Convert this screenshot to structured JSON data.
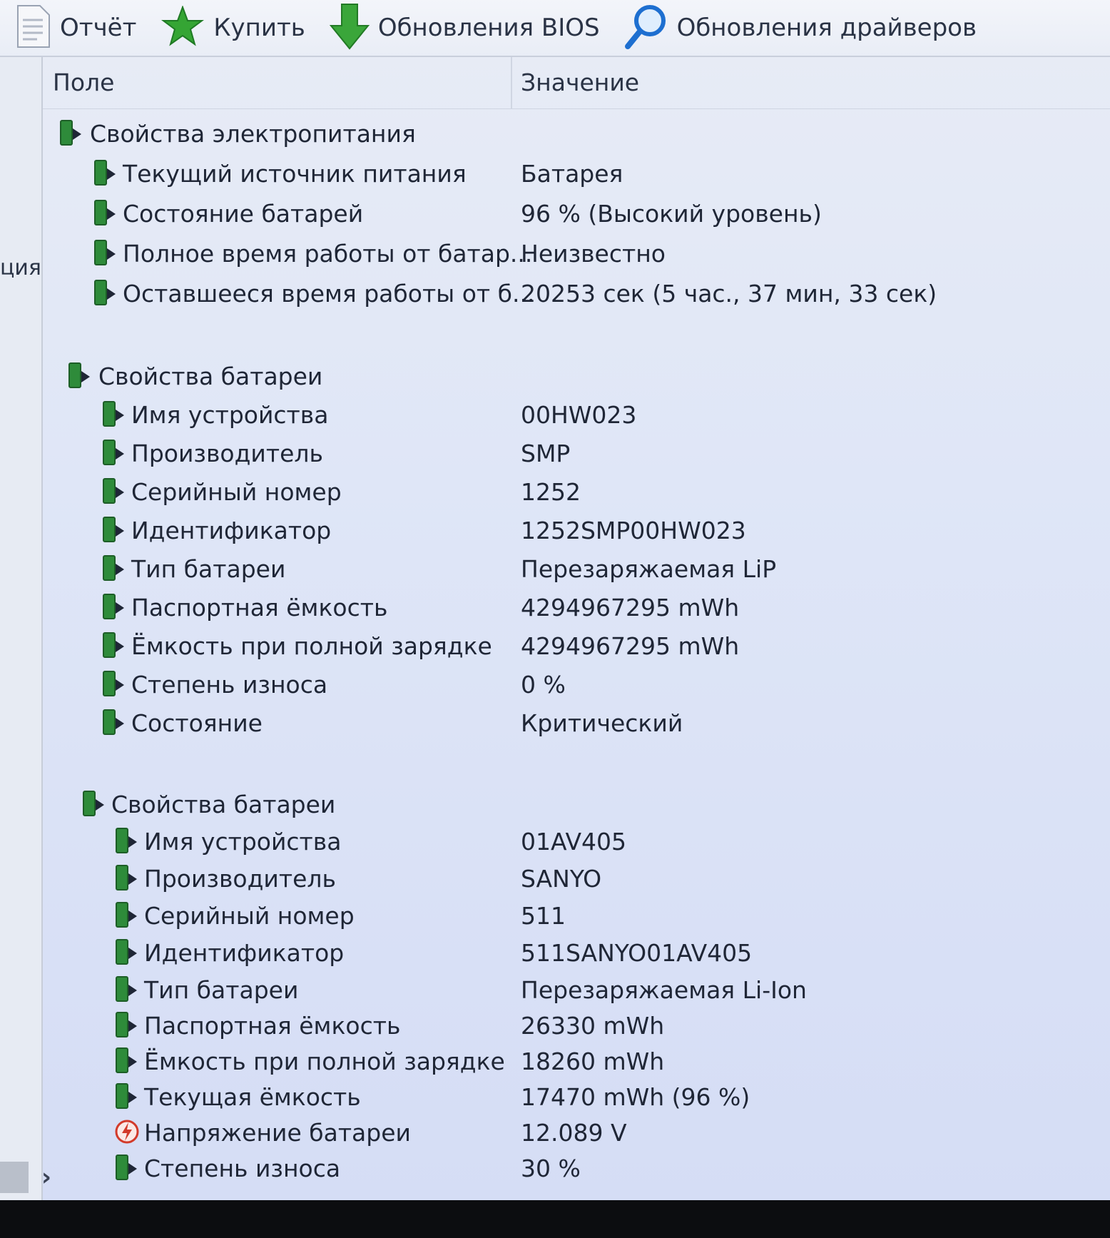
{
  "toolbar": {
    "items": [
      {
        "label": "Отчёт",
        "icon": "report-icon"
      },
      {
        "label": "Купить",
        "icon": "buy-star-icon"
      },
      {
        "label": "Обновления BIOS",
        "icon": "download-arrow-icon"
      },
      {
        "label": "Обновления драйверов",
        "icon": "search-magnifier-icon"
      }
    ]
  },
  "left_pane": {
    "clipped_text": "ция"
  },
  "columns": {
    "field": "Поле",
    "value": "Значение"
  },
  "sections": [
    {
      "title": "Свойства электропитания",
      "rows": [
        {
          "field": "Текущий источник питания",
          "value": "Батарея"
        },
        {
          "field": "Состояние батарей",
          "value": "96 % (Высокий уровень)"
        },
        {
          "field": "Полное время работы от батар...",
          "value": "Неизвестно"
        },
        {
          "field": "Оставшееся время работы от б...",
          "value": "20253 сек (5 час., 37 мин, 33 сек)"
        }
      ]
    },
    {
      "title": "Свойства батареи",
      "rows": [
        {
          "field": "Имя устройства",
          "value": "00HW023"
        },
        {
          "field": "Производитель",
          "value": "SMP"
        },
        {
          "field": "Серийный номер",
          "value": "1252"
        },
        {
          "field": "Идентификатор",
          "value": "1252SMP00HW023"
        },
        {
          "field": "Тип батареи",
          "value": "Перезаряжаемая LiP"
        },
        {
          "field": "Паспортная ёмкость",
          "value": "4294967295 mWh"
        },
        {
          "field": "Ёмкость при полной зарядке",
          "value": "4294967295 mWh"
        },
        {
          "field": "Степень износа",
          "value": "0 %"
        },
        {
          "field": "Состояние",
          "value": "Критический"
        }
      ]
    },
    {
      "title": "Свойства батареи",
      "rows": [
        {
          "field": "Имя устройства",
          "value": "01AV405"
        },
        {
          "field": "Производитель",
          "value": "SANYO"
        },
        {
          "field": "Серийный номер",
          "value": "511"
        },
        {
          "field": "Идентификатор",
          "value": "511SANYO01AV405"
        },
        {
          "field": "Тип батареи",
          "value": "Перезаряжаемая Li-Ion"
        },
        {
          "field": "Паспортная ёмкость",
          "value": "26330 mWh"
        },
        {
          "field": "Ёмкость при полной зарядке",
          "value": "18260 mWh"
        },
        {
          "field": "Текущая ёмкость",
          "value": "17470 mWh  (96 %)"
        },
        {
          "field": "Напряжение батареи",
          "value": "12.089 V",
          "icon": "voltage-icon"
        },
        {
          "field": "Степень износа",
          "value": "30 %"
        }
      ]
    }
  ],
  "colors": {
    "battery_icon": "#2e8b3a",
    "accent_blue": "#1e6fd0",
    "voltage_icon": "#d23a2a"
  }
}
